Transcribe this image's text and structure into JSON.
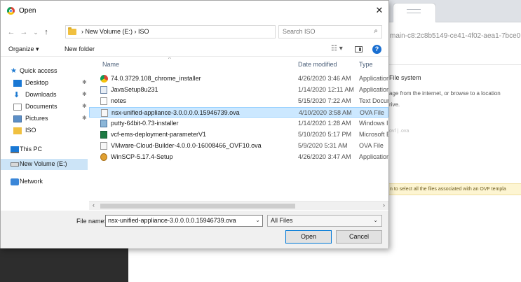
{
  "background": {
    "url_fragment": "main-c8:2c8b5149-ce41-4f02-aea1-7bce0",
    "panel_heading": "File system",
    "panel_desc_line1": "age from the internet, or browse to a location",
    "panel_desc_line2": "rive.",
    "ovf_hint": "ovf | .ova",
    "warning_text": "n to select all the files associated with an OVF templa"
  },
  "dialog": {
    "title": "Open",
    "close_glyph": "✕",
    "nav": {
      "back": "←",
      "forward": "→",
      "recent": "⌄",
      "up": "↑"
    },
    "address": {
      "breadcrumb": "›  New Volume (E:)  ›  ISO",
      "dropdown_glyph": "⌄",
      "refresh_glyph": "↻"
    },
    "search": {
      "placeholder": "Search ISO",
      "icon_glyph": "⌕"
    },
    "toolbar": {
      "organize": "Organize ▾",
      "new_folder": "New folder",
      "view_glyph": "☷ ▾",
      "help_glyph": "?"
    },
    "sidebar": {
      "quick_access": "Quick access",
      "items": [
        {
          "label": "Desktop",
          "pinned": true
        },
        {
          "label": "Downloads",
          "pinned": true
        },
        {
          "label": "Documents",
          "pinned": true
        },
        {
          "label": "Pictures",
          "pinned": true
        },
        {
          "label": "ISO",
          "pinned": false
        }
      ],
      "this_pc": "This PC",
      "new_volume": "New Volume (E:)",
      "network": "Network",
      "pin_glyph": "📌"
    },
    "columns": {
      "name": "Name",
      "date": "Date modified",
      "type": "Type",
      "sort_glyph": "^"
    },
    "files": [
      {
        "name": "74.0.3729.108_chrome_installer",
        "date": "4/26/2020 3:46 AM",
        "type": "Application",
        "icon": "chrome-icon"
      },
      {
        "name": "JavaSetup8u231",
        "date": "1/14/2020 12:11 AM",
        "type": "Application",
        "icon": "java-icon"
      },
      {
        "name": "notes",
        "date": "5/15/2020 7:22 AM",
        "type": "Text Docum",
        "icon": "text-file-icon"
      },
      {
        "name": "nsx-unified-appliance-3.0.0.0.0.15946739.ova",
        "date": "4/10/2020 3:58 AM",
        "type": "OVA File",
        "icon": "ova-file-icon"
      },
      {
        "name": "putty-64bit-0.73-installer",
        "date": "1/14/2020 1:28 AM",
        "type": "Windows In",
        "icon": "putty-icon"
      },
      {
        "name": "vcf-ems-deployment-parameterV1",
        "date": "5/10/2020 5:17 PM",
        "type": "Microsoft E",
        "icon": "excel-icon"
      },
      {
        "name": "VMware-Cloud-Builder-4.0.0.0-16008466_OVF10.ova",
        "date": "5/9/2020 5:31 AM",
        "type": "OVA File",
        "icon": "ova-file-icon"
      },
      {
        "name": "WinSCP-5.17.4-Setup",
        "date": "4/26/2020 3:47 AM",
        "type": "Application",
        "icon": "winscp-icon"
      }
    ],
    "selected_file_index": 3,
    "scroll": {
      "left": "‹",
      "right": "›"
    },
    "bottom": {
      "file_name_label": "File name:",
      "file_name_value": "nsx-unified-appliance-3.0.0.0.0.15946739.ova",
      "filter_value": "All Files",
      "dropdown_glyph": "⌄",
      "open_label": "Open",
      "cancel_label": "Cancel"
    }
  },
  "colors": {
    "selection": "#cce8ff",
    "selection_border": "#99d1ff",
    "sidebar_selection": "#cce4f7",
    "accent": "#0078d7",
    "warning_bg": "#fdf5d2"
  }
}
